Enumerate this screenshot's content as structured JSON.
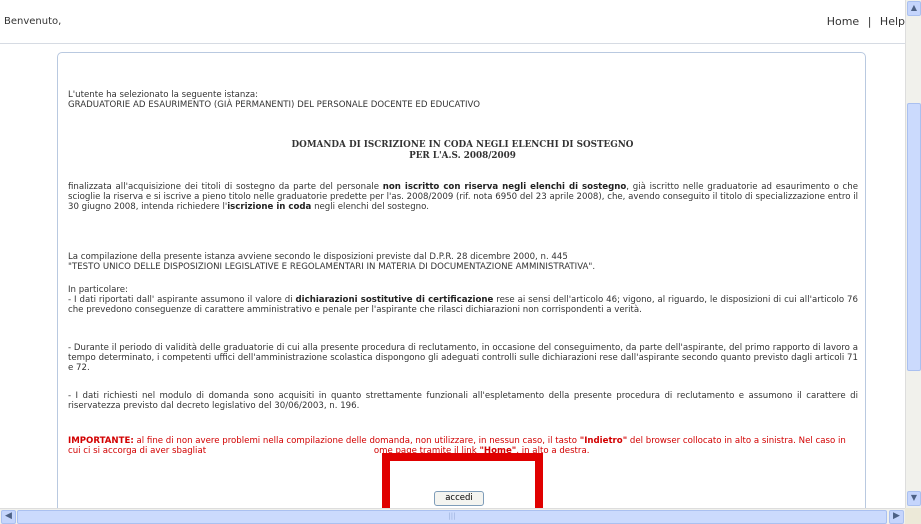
{
  "header": {
    "welcome": "Benvenuto,",
    "home_link": "Home",
    "separator": "|",
    "help_link": "Help"
  },
  "intro": {
    "line1": "L'utente ha selezionato la seguente istanza:",
    "line2": "GRADUATORIE AD ESAURIMENTO (GIÀ PERMANENTI) DEL PERSONALE DOCENTE ED EDUCATIVO"
  },
  "title": {
    "line1": "DOMANDA DI ISCRIZIONE IN CODA NEGLI ELENCHI DI SOSTEGNO",
    "line2": "PER L'A.S. 2008/2009"
  },
  "para1": {
    "a": "finalizzata all'acquisizione dei titoli di sostegno da parte del personale ",
    "b": "non iscritto con riserva negli elenchi di sostegno",
    "c": ", già iscritto nelle graduatorie ad esaurimento o che scioglie la riserva e si iscrive a pieno titolo nelle graduatorie predette per l'as. 2008/2009 (rif. nota 6950 del 23 aprile 2008), che, avendo conseguito il titolo di specializzazione entro il 30 giugno 2008, intenda richiedere l'",
    "d": "iscrizione in coda",
    "e": " negli elenchi del sostegno."
  },
  "para2": {
    "line1": "La compilazione della presente istanza avviene secondo le disposizioni previste dal D.P.R. 28 dicembre 2000, n. 445",
    "line2": "\"TESTO UNICO DELLE DISPOSIZIONI LEGISLATIVE E REGOLAMENTARI IN MATERIA DI DOCUMENTAZIONE AMMINISTRATIVA\"."
  },
  "para3": {
    "heading": "In particolare:",
    "a": "- I dati riportati dall' aspirante assumono il valore di ",
    "b": "dichiarazioni sostitutive di certificazione",
    "c": " rese ai sensi dell'articolo 46; vigono, al riguardo, le disposizioni di cui all'articolo 76 che prevedono conseguenze di carattere amministrativo e penale per l'aspirante che rilasci dichiarazioni non corrispondenti a verità."
  },
  "para4": "- Durante il periodo di validità delle graduatorie di cui alla presente procedura di reclutamento, in occasione del conseguimento, da parte dell'aspirante, del primo rapporto di lavoro a tempo determinato, i competenti uffici dell'amministrazione scolastica dispongono gli adeguati controlli sulle dichiarazioni rese dall'aspirante secondo quanto previsto dagli articoli 71 e 72.",
  "para5": "- I dati richiesti nel modulo di domanda sono acquisiti in quanto strettamente funzionali all'espletamento della presente procedura di reclutamento e assumono il carattere di riservatezza previsto dal decreto legislativo del 30/06/2003, n. 196.",
  "warning": {
    "label": "IMPORTANTE:",
    "a": " al fine di non avere problemi nella compilazione delle domanda, non utilizzare, in nessun caso, il tasto ",
    "b": "\"Indietro\"",
    "c": " del browser collocato in alto a sinistra. Nel caso in cui ci si accorga di aver sbagliat",
    "d": "ome page tramite il link ",
    "e": "\"Home\"",
    "f": ", in alto a destra."
  },
  "accedi_label": "accedi",
  "colors": {
    "accent_red": "#e00000",
    "warning_text": "#d20000",
    "panel_border": "#b9c9e0",
    "scrollbar": "#c5d5fc"
  },
  "icons": [
    "arrow-up-icon",
    "arrow-down-icon",
    "arrow-left-icon",
    "arrow-right-icon"
  ]
}
